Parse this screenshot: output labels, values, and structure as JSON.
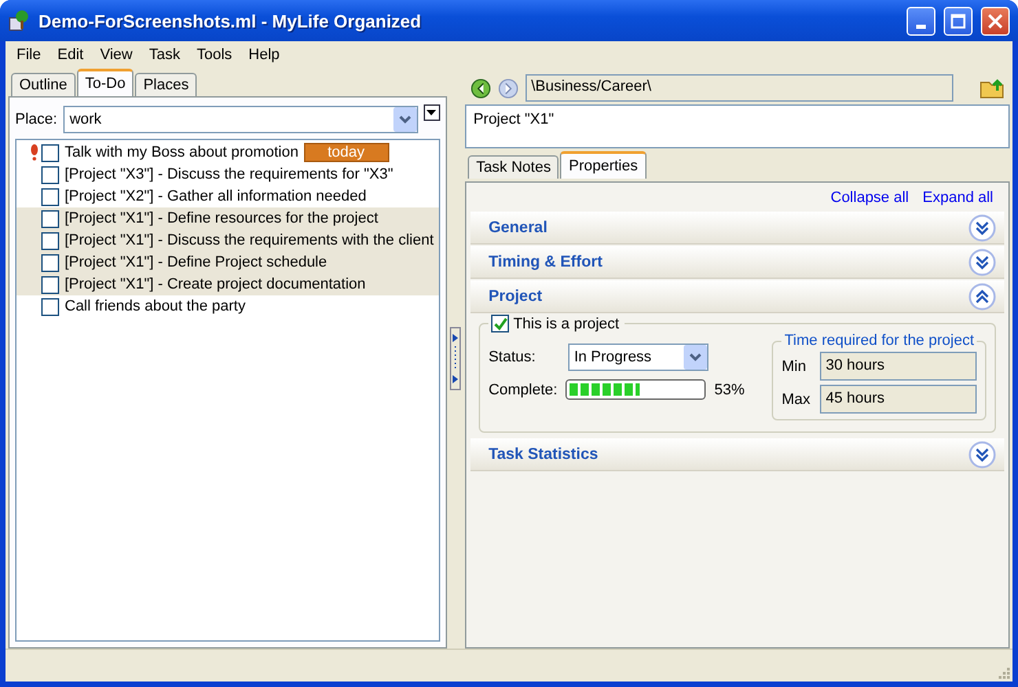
{
  "window": {
    "title": "Demo-ForScreenshots.ml - MyLife Organized"
  },
  "menu": [
    "File",
    "Edit",
    "View",
    "Task",
    "Tools",
    "Help"
  ],
  "left_tabs": [
    {
      "label": "Outline",
      "selected": false
    },
    {
      "label": "To-Do",
      "selected": true
    },
    {
      "label": "Places",
      "selected": false
    }
  ],
  "place": {
    "label": "Place:",
    "value": "work"
  },
  "tasks": [
    {
      "text": "Talk with my Boss about promotion",
      "checked": false,
      "important": true,
      "shaded": false,
      "badge": "today"
    },
    {
      "text": "[Project \"X3\"] - Discuss the requirements for \"X3\"",
      "checked": false,
      "important": false,
      "shaded": false
    },
    {
      "text": "[Project \"X2\"] - Gather all information needed",
      "checked": false,
      "important": false,
      "shaded": false
    },
    {
      "text": "[Project \"X1\"] - Define resources for the project",
      "checked": false,
      "important": false,
      "shaded": true
    },
    {
      "text": "[Project \"X1\"] - Discuss the requirements with the client",
      "checked": false,
      "important": false,
      "shaded": true
    },
    {
      "text": "[Project \"X1\"] - Define Project schedule",
      "checked": false,
      "important": false,
      "shaded": true
    },
    {
      "text": "[Project \"X1\"] - Create project documentation",
      "checked": false,
      "important": false,
      "shaded": true
    },
    {
      "text": "Call friends about the party",
      "checked": false,
      "important": false,
      "shaded": false
    }
  ],
  "path": "\\Business/Career\\",
  "task_title": "Project \"X1\"",
  "right_tabs": [
    {
      "label": "Task Notes",
      "selected": false
    },
    {
      "label": "Properties",
      "selected": true
    }
  ],
  "links": [
    "Collapse all",
    "Expand all"
  ],
  "sections": [
    {
      "title": "General",
      "expanded": false
    },
    {
      "title": "Timing & Effort",
      "expanded": false
    },
    {
      "title": "Project",
      "expanded": true
    },
    {
      "title": "Task Statistics",
      "expanded": false
    }
  ],
  "project": {
    "is_project": {
      "label": "This is a project",
      "checked": true
    },
    "status": {
      "label": "Status:",
      "value": "In Progress"
    },
    "complete": {
      "label": "Complete:",
      "level": 0.53,
      "reading": "53%"
    },
    "time": {
      "title": "Time required for the project",
      "min_label": "Min",
      "min": "30 hours",
      "max_label": "Max",
      "max": "45 hours"
    }
  }
}
